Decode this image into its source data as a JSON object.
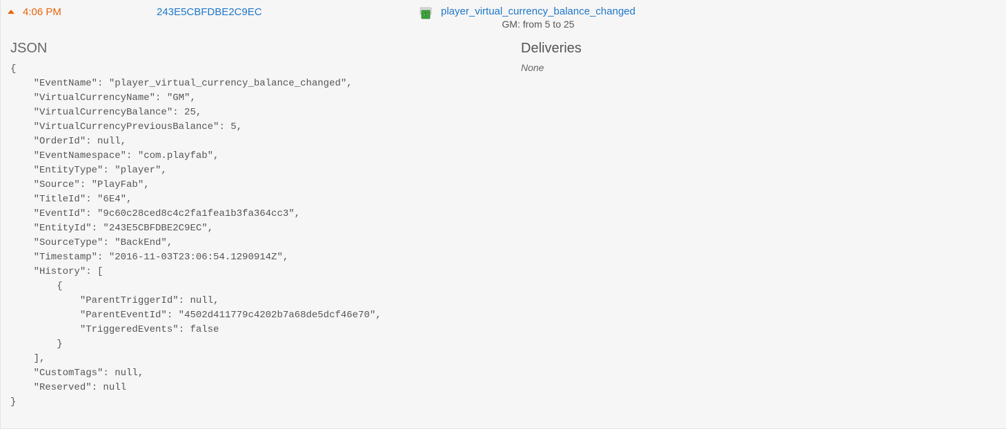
{
  "row": {
    "time": "4:06 PM",
    "entity_id": "243E5CBFDBE2C9EC",
    "event_name": "player_virtual_currency_balance_changed",
    "event_subtitle": "GM: from 5 to 25"
  },
  "panels": {
    "json_title": "JSON",
    "deliveries_title": "Deliveries",
    "deliveries_none": "None"
  },
  "json_lines": {
    "l0": "{",
    "l1": "    \"EventName\": \"player_virtual_currency_balance_changed\",",
    "l2": "    \"VirtualCurrencyName\": \"GM\",",
    "l3": "    \"VirtualCurrencyBalance\": 25,",
    "l4": "    \"VirtualCurrencyPreviousBalance\": 5,",
    "l5": "    \"OrderId\": null,",
    "l6": "    \"EventNamespace\": \"com.playfab\",",
    "l7": "    \"EntityType\": \"player\",",
    "l8": "    \"Source\": \"PlayFab\",",
    "l9": "    \"TitleId\": \"6E4\",",
    "l10": "    \"EventId\": \"9c60c28ced8c4c2fa1fea1b3fa364cc3\",",
    "l11": "    \"EntityId\": \"243E5CBFDBE2C9EC\",",
    "l12": "    \"SourceType\": \"BackEnd\",",
    "l13": "    \"Timestamp\": \"2016-11-03T23:06:54.1290914Z\",",
    "l14": "    \"History\": [",
    "l15": "        {",
    "l16": "            \"ParentTriggerId\": null,",
    "l17": "            \"ParentEventId\": \"4502d411779c4202b7a68de5dcf46e70\",",
    "l18": "            \"TriggeredEvents\": false",
    "l19": "        }",
    "l20": "    ],",
    "l21": "    \"CustomTags\": null,",
    "l22": "    \"Reserved\": null",
    "l23": "}"
  }
}
